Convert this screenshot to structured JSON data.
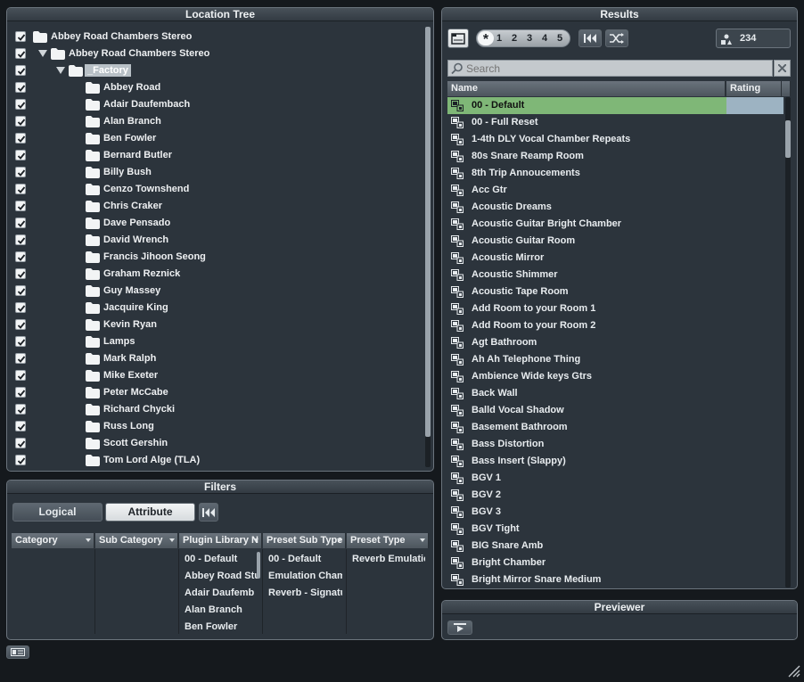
{
  "location_tree": {
    "title": "Location Tree",
    "items": [
      {
        "label": "Abbey Road Chambers Stereo",
        "level": 0,
        "expander": false
      },
      {
        "label": "Abbey Road Chambers Stereo",
        "level": 1,
        "expander": true
      },
      {
        "label": "_Factory",
        "level": 2,
        "expander": true,
        "selected": true
      },
      {
        "label": "Abbey Road",
        "level": 3
      },
      {
        "label": "Adair Daufembach",
        "level": 3
      },
      {
        "label": "Alan Branch",
        "level": 3
      },
      {
        "label": "Ben Fowler",
        "level": 3
      },
      {
        "label": "Bernard Butler",
        "level": 3
      },
      {
        "label": "Billy Bush",
        "level": 3
      },
      {
        "label": "Cenzo Townshend",
        "level": 3
      },
      {
        "label": "Chris Craker",
        "level": 3
      },
      {
        "label": "Dave Pensado",
        "level": 3
      },
      {
        "label": "David Wrench",
        "level": 3
      },
      {
        "label": "Francis Jihoon Seong",
        "level": 3
      },
      {
        "label": "Graham Reznick",
        "level": 3
      },
      {
        "label": "Guy Massey",
        "level": 3
      },
      {
        "label": "Jacquire King",
        "level": 3
      },
      {
        "label": "Kevin Ryan",
        "level": 3
      },
      {
        "label": "Lamps",
        "level": 3
      },
      {
        "label": "Mark Ralph",
        "level": 3
      },
      {
        "label": "Mike Exeter",
        "level": 3
      },
      {
        "label": "Peter McCabe",
        "level": 3
      },
      {
        "label": "Richard Chycki",
        "level": 3
      },
      {
        "label": "Russ Long",
        "level": 3
      },
      {
        "label": "Scott Gershin",
        "level": 3
      },
      {
        "label": "Tom Lord Alge (TLA)",
        "level": 3
      }
    ]
  },
  "filters": {
    "title": "Filters",
    "logical_label": "Logical",
    "attribute_label": "Attribute",
    "columns": [
      {
        "header": "Category",
        "values": []
      },
      {
        "header": "Sub Category",
        "values": []
      },
      {
        "header": "Plugin Library N",
        "values": [
          "00 - Default",
          "Abbey Road Stu",
          "Adair Daufemb",
          "Alan Branch",
          "Ben Fowler"
        ]
      },
      {
        "header": "Preset Sub Type",
        "values": [
          "00 - Default",
          "Emulation Chaml",
          "Reverb - Signatu"
        ]
      },
      {
        "header": "Preset Type",
        "values": [
          "Reverb Emulation"
        ]
      }
    ]
  },
  "results": {
    "title": "Results",
    "rating_filter": "*",
    "rating_numbers": [
      "1",
      "2",
      "3",
      "4",
      "5"
    ],
    "count": "234",
    "search_placeholder": "Search",
    "col_name": "Name",
    "col_rating": "Rating",
    "items": [
      "00 - Default",
      "00 - Full Reset",
      "1-4th DLY Vocal Chamber Repeats",
      "80s Snare Reamp Room",
      "8th Trip Annoucements",
      "Acc Gtr",
      "Acoustic Dreams",
      "Acoustic Guitar Bright Chamber",
      "Acoustic Guitar Room",
      "Acoustic Mirror",
      "Acoustic Shimmer",
      "Acoustic Tape Room",
      "Add Room to your Room 1",
      "Add Room to your Room 2",
      "Agt Bathroom",
      "Ah Ah Telephone Thing",
      "Ambience Wide keys Gtrs",
      "Back Wall",
      "Balld Vocal Shadow",
      "Basement Bathroom",
      "Bass Distortion",
      "Bass Insert (Slappy)",
      "BGV 1",
      "BGV 2",
      "BGV 3",
      "BGV Tight",
      "BIG Snare Amb",
      "Bright Chamber",
      "Bright Mirror Snare Medium"
    ],
    "selected_index": 0
  },
  "previewer": {
    "title": "Previewer"
  },
  "colors": {
    "selected_row": "#7fb777",
    "accent": "#9db3c2"
  }
}
